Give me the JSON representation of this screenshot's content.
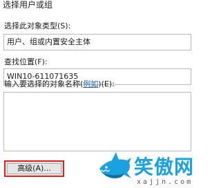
{
  "dialog": {
    "title": "选择用户或组",
    "object_type": {
      "label_text": "选择此对象类型",
      "hotkey": "(S):",
      "value": "用户、组或内置安全主体"
    },
    "location": {
      "label_text": "查找位置",
      "hotkey": "(F):",
      "value": "WIN10-611071635"
    },
    "names": {
      "label_prefix": "输入要选择的对象名称(",
      "example_link": "例如",
      "label_suffix": ")(E):",
      "value": ""
    },
    "advanced_button": "高级(A)..."
  },
  "watermark": {
    "brand": "笑傲网",
    "domain": "xajjn.com",
    "logo_icon": "shark-icon",
    "colors": {
      "brand": "#1aa1df",
      "highlight": "#e0201a"
    }
  }
}
